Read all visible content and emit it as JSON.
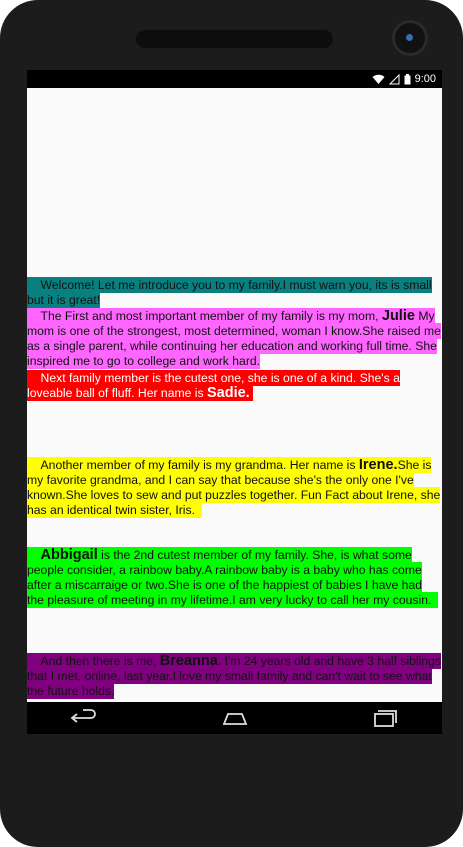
{
  "status": {
    "time": "9:00"
  },
  "paragraphs": {
    "intro": "Welcome! Let me introduce you to my family.I must warn you, its is small but it is great!",
    "mom_a": "The First and most important member of my family is my mom, ",
    "mom_name": "Julie",
    "mom_b": "My mom is one of the strongest, most determined, woman I know.She raised me as a single parent, while continuing her education and working full time. She inspired me to go to college and work hard.",
    "dog_a": "Next family member is the cutest one, she is one of a kind. She's a loveable ball of fluff. Her name is ",
    "dog_name": "Sadie.",
    "grandma_a": "Another member of my family is my grandma. Her name is ",
    "grandma_name": "Irene.",
    "grandma_b": "She is my favorite grandma, and I can say that because she's the only one I've known.She loves to sew and put puzzles together. Fun Fact about Irene, she has an identical twin sister, Iris.",
    "sister_name": "Abbigail",
    "sister_b": " is the 2nd cutest member of my family. She, is what some people consider, a rainbow baby.A rainbow baby is a baby who has come after a miscarraige or two.She is one of the happiest of babies I have had the pleasure of meeting in my lifetime.I am very lucky to call her my cousin.",
    "me_a": "And then there is me, ",
    "me_name": "Breanna",
    "me_b": ". I'm 24 years old and have 3 half siblings that I met, online, last year.I love my small family and can't wait to see what the future holds."
  },
  "nav": {
    "back_icon": "back-arrow-icon",
    "home_icon": "home-icon",
    "recents_icon": "recents-icon"
  },
  "colors": {
    "teal": "#098080",
    "pink": "#ff66ff",
    "red": "#ff0000",
    "yellow": "#ffff00",
    "green": "#00ff00",
    "purple": "#800080"
  }
}
